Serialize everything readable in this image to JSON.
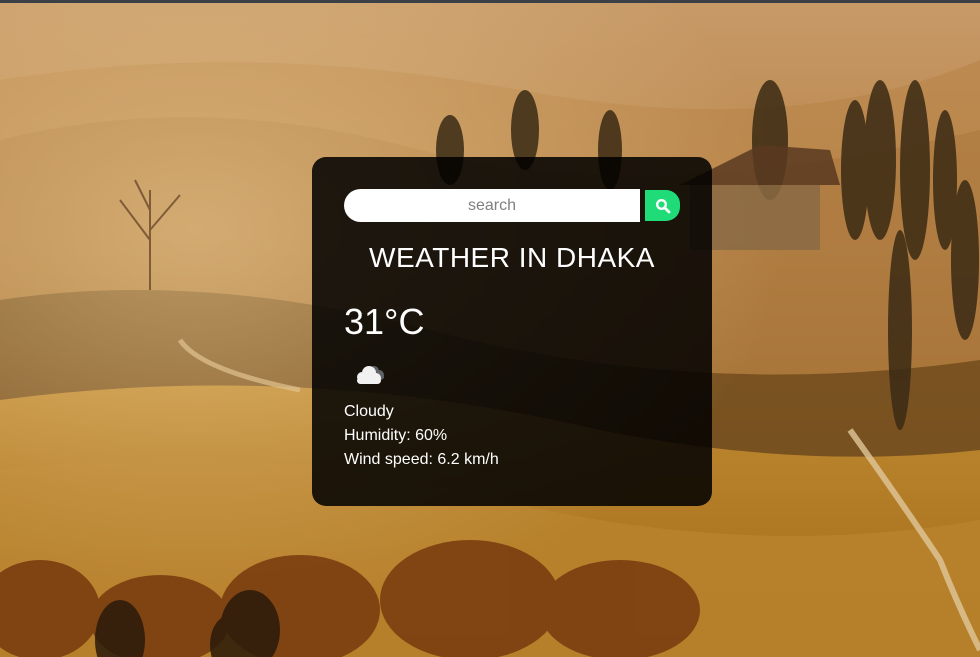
{
  "search": {
    "placeholder": "search",
    "value": ""
  },
  "weather": {
    "city_heading": "WEATHER IN DHAKA",
    "temperature": "31°C",
    "icon": "cloudy-icon",
    "description": "Cloudy",
    "humidity": "Humidity: 60%",
    "wind_speed": "Wind speed: 6.2 km/h"
  },
  "colors": {
    "accent": "#1fdc79",
    "card_background": "#000000",
    "text": "#ffffff"
  }
}
